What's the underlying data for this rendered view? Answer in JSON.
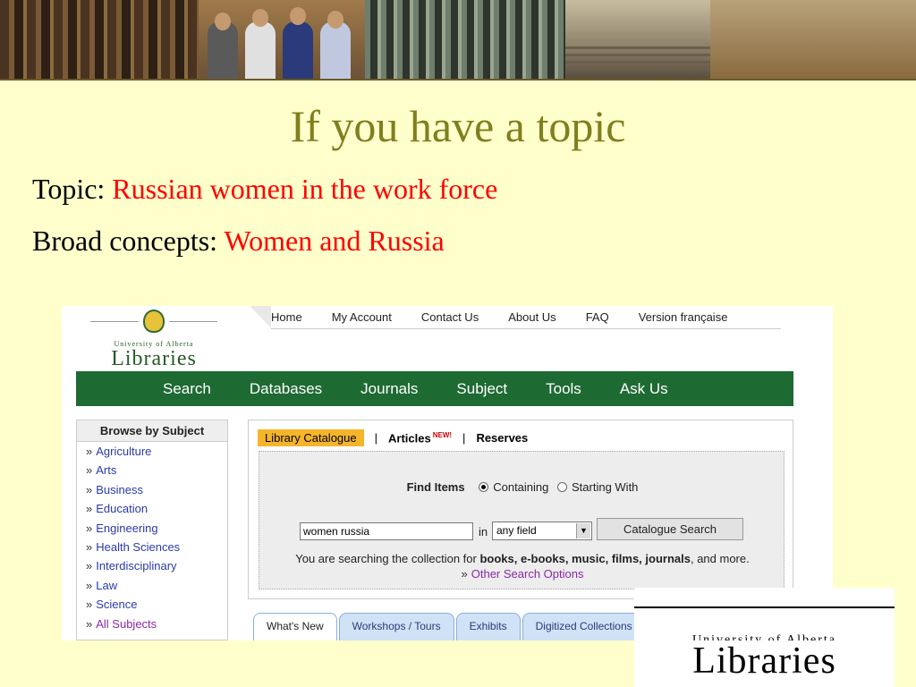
{
  "slide": {
    "title": "If you have a topic",
    "topic_label": "Topic: ",
    "topic_value": "Russian women in the work force",
    "concepts_label": "Broad concepts: ",
    "concepts_value": "Women and Russia",
    "accent_title_color": "#7f7f1e",
    "accent_red": "#ff0000"
  },
  "screenshot": {
    "logo": {
      "university": "University of Alberta",
      "libraries": "Libraries"
    },
    "top_nav": [
      "Home",
      "My Account",
      "Contact Us",
      "About Us",
      "FAQ",
      "Version française"
    ],
    "main_nav": [
      "Search",
      "Databases",
      "Journals",
      "Subject",
      "Tools",
      "Ask Us"
    ],
    "browse": {
      "header": "Browse by Subject",
      "arrow": "»",
      "items": [
        "Agriculture",
        "Arts",
        "Business",
        "Education",
        "Engineering",
        "Health Sciences",
        "Interdisciplinary",
        "Law",
        "Science",
        "All Subjects"
      ]
    },
    "catalogue": {
      "tab_active": "Library Catalogue",
      "separator": "|",
      "tab_articles": "Articles",
      "new_badge": "NEW!",
      "tab_reserves": "Reserves",
      "find_label": "Find Items",
      "radio_containing": "Containing",
      "radio_starting": "Starting With",
      "search_value": "women russia",
      "in_label": "in",
      "field_select": "any field",
      "search_button": "Catalogue Search",
      "note_pre": "You are searching the collection for ",
      "note_bold": "books, e-books, music, films, journals",
      "note_post": ", and more.",
      "other_options": "Other Search Options"
    },
    "bottom_tabs": [
      "What's New",
      "Workshops / Tours",
      "Exhibits",
      "Digitized Collections"
    ],
    "green": "#1e6a33"
  },
  "corner_logo": {
    "university": "University of Alberta",
    "libraries": "Libraries"
  }
}
